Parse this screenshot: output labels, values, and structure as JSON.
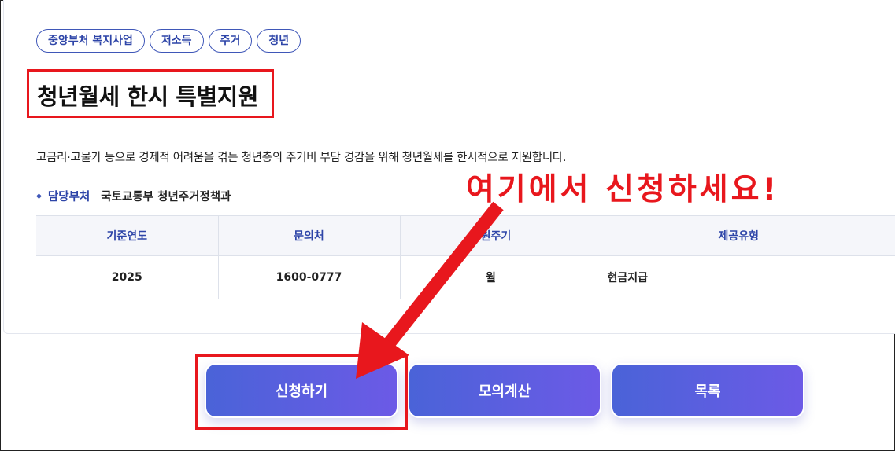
{
  "tags": [
    "중앙부처 복지사업",
    "저소득",
    "주거",
    "청년"
  ],
  "title": "청년월세 한시 특별지원",
  "description": "고금리·고물가 등으로 경제적 어려움을 겪는 청년층의 주거비 부담 경감을 위해 청년월세를 한시적으로 지원합니다.",
  "department": {
    "label": "담당부처",
    "value": "국토교통부 청년주거정책과"
  },
  "table": {
    "headers": [
      "기준연도",
      "문의처",
      "지원주기",
      "제공유형"
    ],
    "row": [
      "2025",
      "1600-0777",
      "월",
      "현금지급"
    ]
  },
  "buttons": {
    "apply": "신청하기",
    "mock_calc": "모의계산",
    "list": "목록"
  },
  "annotation": "여기에서 신청하세요!",
  "colors": {
    "accent": "#2e45a8",
    "annotation_red": "#e8171d",
    "button_gradient_start": "#4a63d8",
    "button_gradient_end": "#6c5ae6"
  }
}
